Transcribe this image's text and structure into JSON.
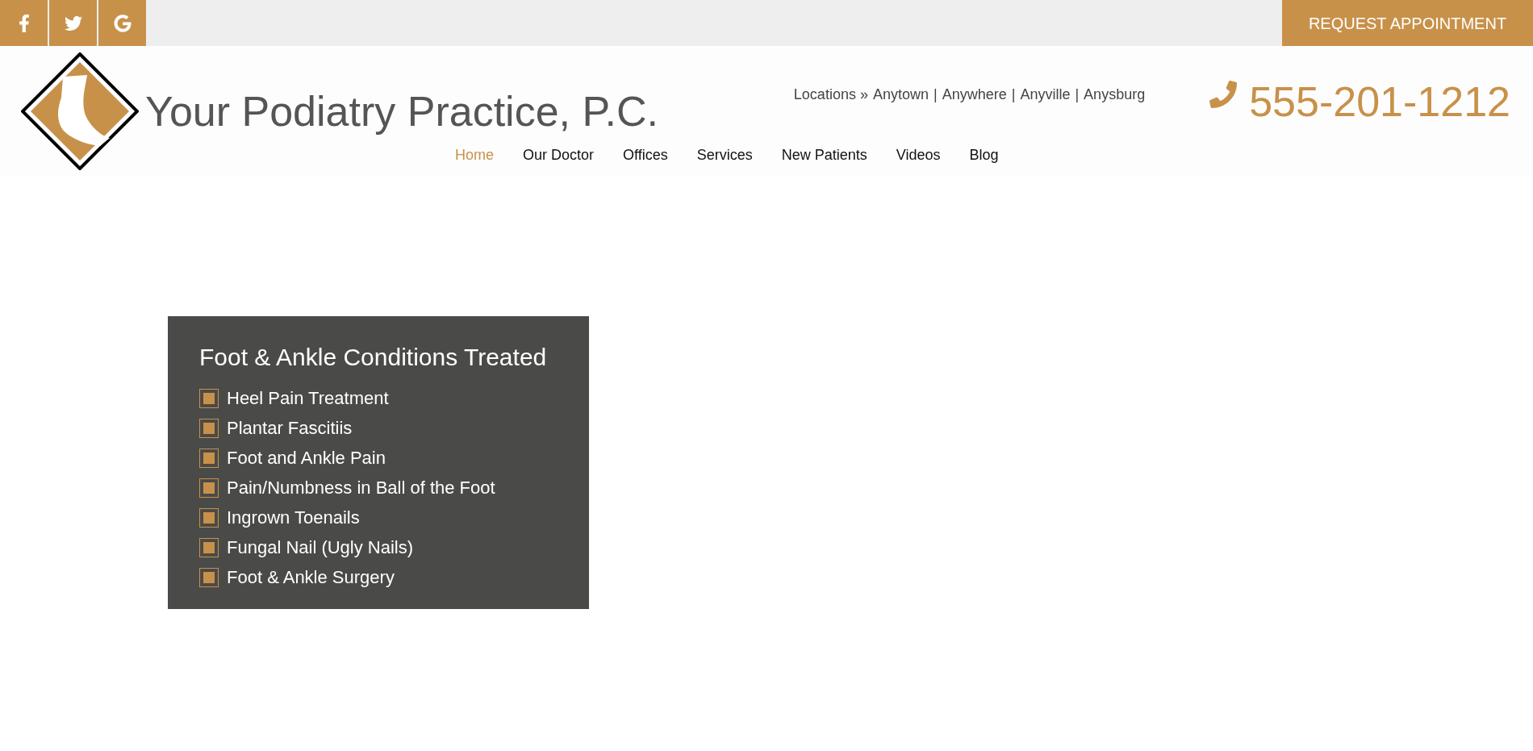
{
  "top_bar": {
    "social": [
      {
        "kind": "facebook"
      },
      {
        "kind": "twitter"
      },
      {
        "kind": "google"
      }
    ],
    "cta": "REQUEST APPOINTMENT"
  },
  "header": {
    "site_title": "Your Podiatry Practice, P.C.",
    "locations_label": "Locations »",
    "separator": "|",
    "locations": [
      "Anytown",
      "Anywhere",
      "Anyville",
      "Anysburg"
    ],
    "phone": "555-201-1212"
  },
  "nav": [
    {
      "label": "Home",
      "selected": true
    },
    {
      "label": "Our Doctor",
      "selected": false
    },
    {
      "label": "Offices",
      "selected": false
    },
    {
      "label": "Services",
      "selected": false
    },
    {
      "label": "New Patients",
      "selected": false
    },
    {
      "label": "Videos",
      "selected": false
    },
    {
      "label": "Blog",
      "selected": false
    }
  ],
  "conditions": {
    "title": "Foot & Ankle Conditions Treated",
    "items": [
      "Heel Pain Treatment",
      "Plantar Fascitiis",
      "Foot and Ankle Pain",
      "Pain/Numbness in Ball of the Foot",
      "Ingrown Toenails",
      "Fungal Nail (Ugly Nails)",
      "Foot & Ankle Surgery"
    ]
  }
}
